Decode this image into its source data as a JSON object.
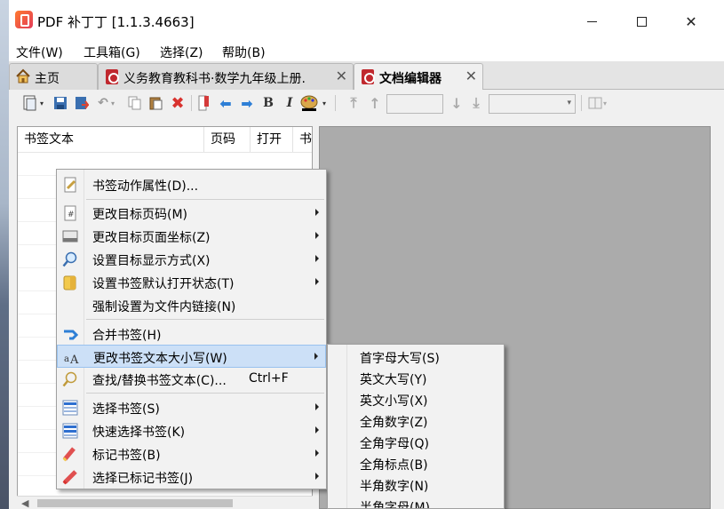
{
  "window": {
    "title": "PDF 补丁丁 [1.1.3.4663]"
  },
  "menubar": [
    "文件(W)",
    "工具箱(G)",
    "选择(Z)",
    "帮助(B)"
  ],
  "tabs": [
    {
      "label": "主页",
      "icon": "home-icon",
      "active": false
    },
    {
      "label": "义务教育教科书·数学九年级上册.",
      "icon": "pdf-icon",
      "active": false
    },
    {
      "label": "文档编辑器",
      "icon": "pdf-icon",
      "active": true
    }
  ],
  "bookmark_list": {
    "columns": [
      "书签文本",
      "页码",
      "打开",
      "书"
    ]
  },
  "context_menu": {
    "items": [
      {
        "label": "书签动作属性(D)...",
        "icon": "edit-properties-icon",
        "submenu": false
      },
      {
        "label": "更改目标页码(M)",
        "icon": "page-number-icon",
        "submenu": true
      },
      {
        "label": "更改目标页面坐标(Z)",
        "icon": "page-coordinate-icon",
        "submenu": true
      },
      {
        "label": "设置目标显示方式(X)",
        "icon": "magnifier-icon",
        "submenu": true
      },
      {
        "label": "设置书签默认打开状态(T)",
        "icon": "folder-icon",
        "submenu": true
      },
      {
        "label": "强制设置为文件内链接(N)",
        "icon": "",
        "submenu": false
      },
      {
        "label": "合并书签(H)",
        "icon": "merge-icon",
        "submenu": false
      },
      {
        "label": "更改书签文本大小写(W)",
        "icon": "text-case-icon",
        "submenu": true,
        "highlighted": true
      },
      {
        "label": "查找/替换书签文本(C)...",
        "icon": "find-replace-icon",
        "submenu": false,
        "shortcut": "Ctrl+F"
      },
      {
        "label": "选择书签(S)",
        "icon": "select-list-icon",
        "submenu": true
      },
      {
        "label": "快速选择书签(K)",
        "icon": "quick-select-icon",
        "submenu": true
      },
      {
        "label": "标记书签(B)",
        "icon": "marker-icon",
        "submenu": true
      },
      {
        "label": "选择已标记书签(J)",
        "icon": "marked-select-icon",
        "submenu": true
      }
    ]
  },
  "case_submenu": {
    "items": [
      "首字母大写(S)",
      "英文大写(Y)",
      "英文小写(X)",
      "全角数字(Z)",
      "全角字母(Q)",
      "全角标点(B)",
      "半角数字(N)",
      "半角字母(M)"
    ]
  },
  "colors": {
    "menu_highlight": "#cce0f7",
    "menu_highlight_border": "#99c2ef",
    "editor_background": "#ababab"
  }
}
